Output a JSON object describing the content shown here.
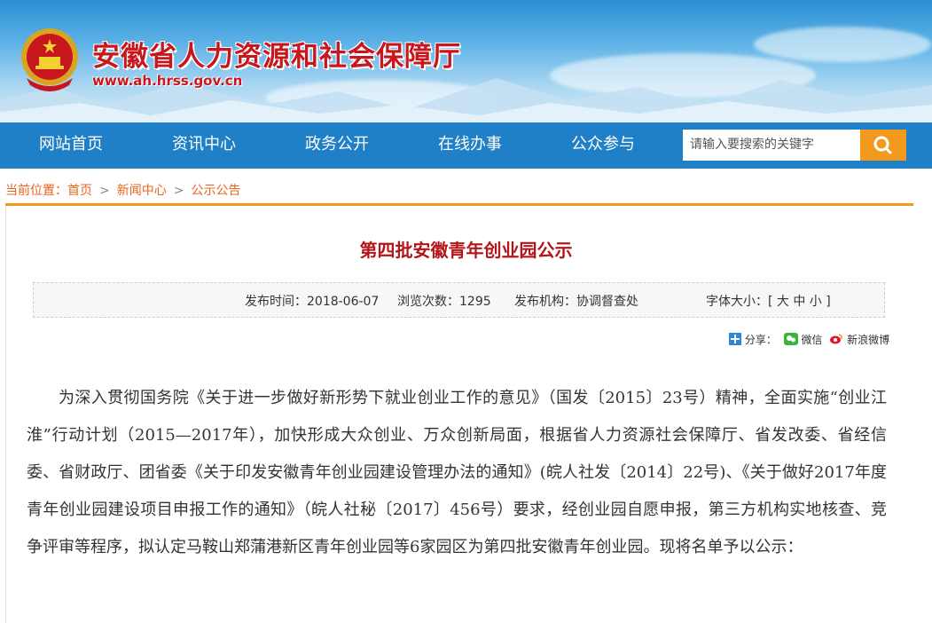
{
  "header": {
    "site_title": "安徽省人力资源和社会保障厅",
    "site_url": "www.ah.hrss.gov.cn"
  },
  "nav": {
    "items": [
      "网站首页",
      "资讯中心",
      "政务公开",
      "在线办事",
      "公众参与"
    ],
    "search_placeholder": "请输入要搜索的关键字"
  },
  "breadcrumb": {
    "prefix": "当前位置：",
    "items": [
      "首页",
      "新闻中心",
      "公示公告"
    ],
    "separator": ">"
  },
  "article": {
    "title": "第四批安徽青年创业园公示",
    "publish_time": "发布时间：2018-06-07",
    "views": "浏览次数：1295",
    "org": "发布机构：协调督查处",
    "font_size_label": "字体大小：[ 大  中  小 ]",
    "share_label": "分享：",
    "share_wechat": "微信",
    "share_weibo": "新浪微博",
    "body": "为深入贯彻国务院《关于进一步做好新形势下就业创业工作的意见》（国发〔2015〕23号）精神，全面实施“创业江淮”行动计划（2015—2017年），加快形成大众创业、万众创新局面，根据省人力资源社会保障厅、省发改委、省经信委、省财政厅、团省委《关于印发安徽青年创业园建设管理办法的通知》(皖人社发〔2014〕22号)、《关于做好2017年度青年创业园建设项目申报工作的通知》（皖人社秘〔2017〕456号）要求，经创业园自愿申报，第三方机构实地核查、竞争评审等程序，拟认定马鞍山郑蒲港新区青年创业园等6家园区为第四批安徽青年创业园。现将名单予以公示："
  },
  "colors": {
    "brand_red": "#c8161d",
    "nav_blue": "#1f7fc7",
    "accent_orange": "#f39a1e"
  }
}
